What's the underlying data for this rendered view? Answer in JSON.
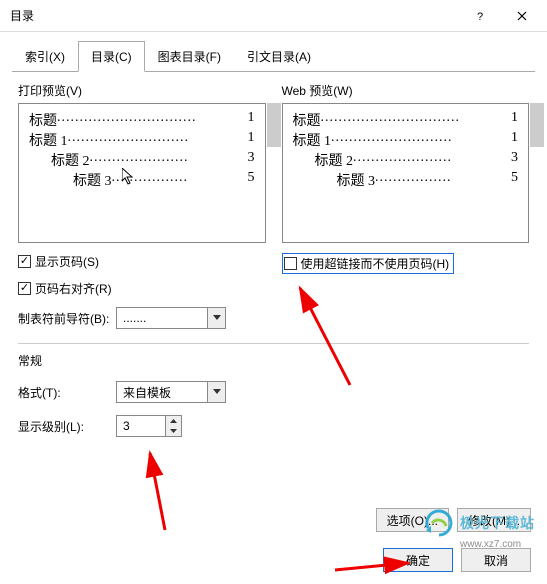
{
  "title": "目录",
  "tabs": [
    "索引(X)",
    "目录(C)",
    "图表目录(F)",
    "引文目录(A)"
  ],
  "active_tab": 1,
  "print_preview": {
    "label": "打印预览(V)",
    "rows": [
      {
        "indent": 1,
        "text": "标题",
        "num": "1"
      },
      {
        "indent": 1,
        "text": "标题 1",
        "num": "1"
      },
      {
        "indent": 2,
        "text": "标题 2",
        "num": "3"
      },
      {
        "indent": 3,
        "text": "标题 3",
        "num": "5"
      }
    ]
  },
  "web_preview": {
    "label": "Web 预览(W)",
    "rows": [
      {
        "indent": 1,
        "text": "标题",
        "num": "1"
      },
      {
        "indent": 1,
        "text": "标题 1",
        "num": "1"
      },
      {
        "indent": 2,
        "text": "标题 2",
        "num": "3"
      },
      {
        "indent": 3,
        "text": "标题 3",
        "num": "5"
      }
    ]
  },
  "checkboxes": {
    "show_page_num": {
      "label": "显示页码(S)",
      "checked": true
    },
    "right_align": {
      "label": "页码右对齐(R)",
      "checked": true
    },
    "use_hyperlink": {
      "label": "使用超链接而不使用页码(H)",
      "checked": false
    }
  },
  "tab_leader": {
    "label": "制表符前导符(B):",
    "value": "......."
  },
  "general": {
    "title": "常规",
    "format": {
      "label": "格式(T):",
      "value": "来自模板"
    },
    "levels": {
      "label": "显示级别(L):",
      "value": "3"
    }
  },
  "buttons": {
    "options": "选项(O)...",
    "modify": "修改(M)...",
    "ok": "确定",
    "cancel": "取消"
  },
  "watermark": {
    "text": "极光下载站",
    "url": "www.xz7.com"
  }
}
